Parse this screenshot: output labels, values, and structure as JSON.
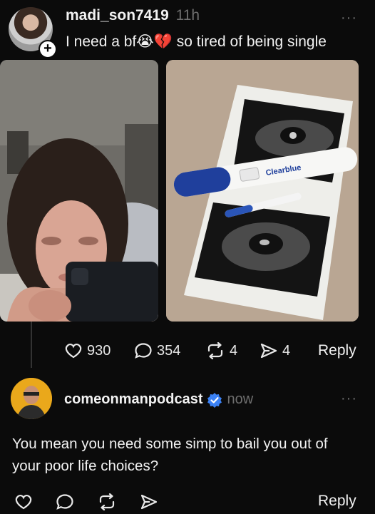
{
  "post": {
    "username": "madi_son7419",
    "time": "11h",
    "text_before": "I need a bf",
    "emoji_1": "😭",
    "emoji_2": "💔",
    "text_after": " so tired of being single",
    "test_brand": "Clearblue",
    "stats": {
      "likes": "930",
      "comments": "354",
      "reposts": "4",
      "shares": "4",
      "reply_label": "Reply"
    }
  },
  "reply": {
    "username": "comeonmanpodcast",
    "time": "now",
    "text": "You mean you need some simp to bail you out of your poor life choices?",
    "reply_label": "Reply"
  },
  "colors": {
    "background": "#0b0b0b",
    "verified": "#3b82f6",
    "muted": "#6f6f6f"
  }
}
